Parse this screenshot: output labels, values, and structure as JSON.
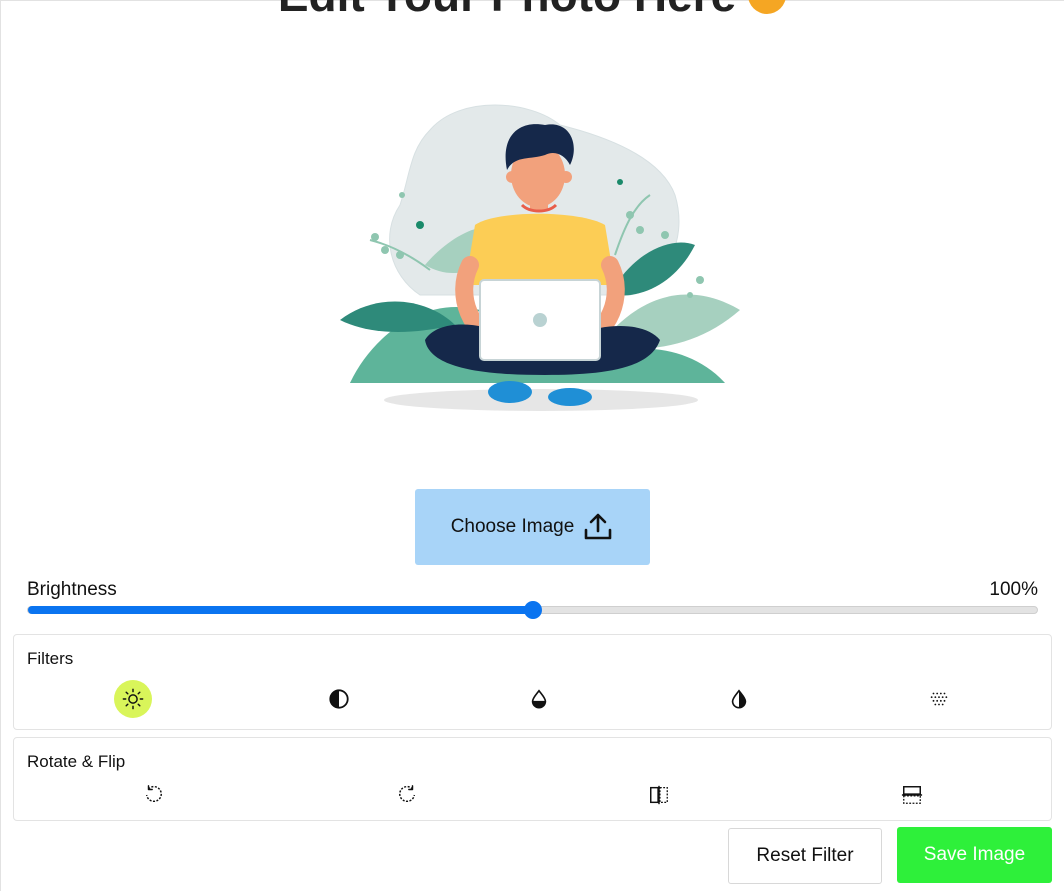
{
  "header": {
    "title": "Edit Your Photo Here"
  },
  "upload": {
    "choose_label": "Choose Image"
  },
  "slider": {
    "label": "Brightness",
    "value_text": "100%",
    "fraction": 0.5
  },
  "filters": {
    "title": "Filters",
    "items": [
      {
        "name": "brightness",
        "icon": "sun-icon",
        "active": true
      },
      {
        "name": "contrast",
        "icon": "half-circle-icon",
        "active": false
      },
      {
        "name": "saturation",
        "icon": "droplet-half-icon",
        "active": false
      },
      {
        "name": "inversion",
        "icon": "contrast-drop-icon",
        "active": false
      },
      {
        "name": "grayscale",
        "icon": "dots-grid-icon",
        "active": false
      }
    ]
  },
  "rotate": {
    "title": "Rotate & Flip",
    "items": [
      {
        "name": "rotate-left",
        "icon": "rotate-left-icon"
      },
      {
        "name": "rotate-right",
        "icon": "rotate-right-icon"
      },
      {
        "name": "flip-horizontal",
        "icon": "flip-horizontal-icon"
      },
      {
        "name": "flip-vertical",
        "icon": "flip-vertical-icon"
      }
    ]
  },
  "actions": {
    "reset_label": "Reset Filter",
    "save_label": "Save Image"
  },
  "colors": {
    "accent": "#0a74f0",
    "active_filter": "#d9f55a",
    "save": "#2ef03a",
    "upload": "#a8d4f8"
  }
}
